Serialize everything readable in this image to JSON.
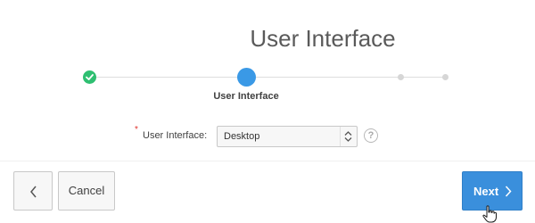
{
  "page": {
    "title": "User Interface"
  },
  "progress": {
    "steps": [
      {
        "state": "complete",
        "icon": "check-icon"
      },
      {
        "state": "current",
        "label": "User Interface"
      },
      {
        "state": "upcoming"
      },
      {
        "state": "upcoming"
      }
    ],
    "current_step_label": "User Interface",
    "colors": {
      "complete": "#2ebf71",
      "current": "#3a99e6",
      "upcoming": "#d6d6d6"
    }
  },
  "form": {
    "required_mark": "*",
    "label": "User Interface:",
    "select_value": "Desktop",
    "help_text": "?"
  },
  "buttons": {
    "back_icon": "chevron-left-icon",
    "cancel_label": "Cancel",
    "next_label": "Next",
    "next_icon": "chevron-right-icon",
    "next_color": "#3a8fdc"
  },
  "cursor": "hand-pointer-icon"
}
